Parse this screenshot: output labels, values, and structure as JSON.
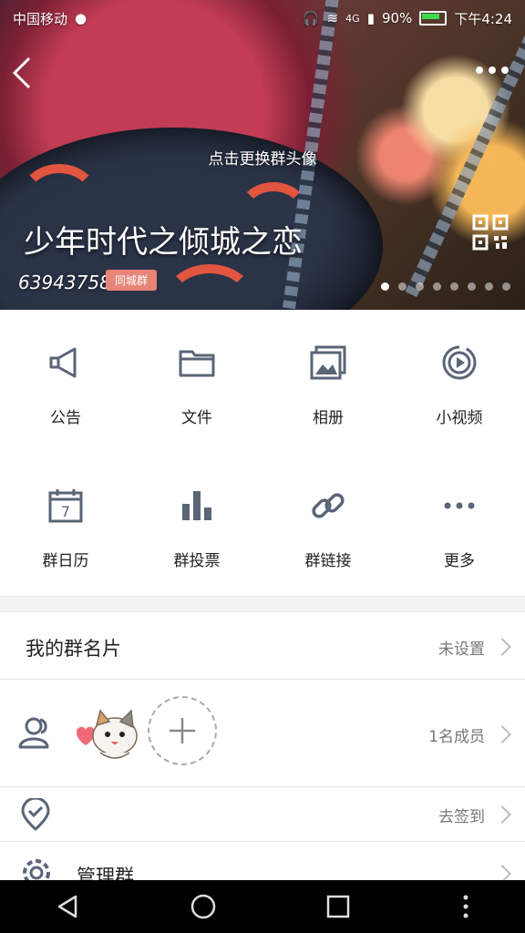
{
  "status_bar": {
    "carrier": "中国移动",
    "network": "4G",
    "battery": "90%",
    "time": "下午4:24"
  },
  "header": {
    "change_avatar_label": "点击更换群头像",
    "group_name": "少年时代之倾城之恋",
    "group_id": "639437589",
    "badge": "同城群",
    "carousel_active_index": 0,
    "carousel_count": 8
  },
  "grid": {
    "row1": [
      {
        "label": "公告",
        "icon": "megaphone-icon"
      },
      {
        "label": "文件",
        "icon": "folder-icon"
      },
      {
        "label": "相册",
        "icon": "photo-album-icon"
      },
      {
        "label": "小视频",
        "icon": "video-icon"
      }
    ],
    "row2": [
      {
        "label": "群日历",
        "icon": "calendar-icon"
      },
      {
        "label": "群投票",
        "icon": "bar-chart-icon"
      },
      {
        "label": "群链接",
        "icon": "link-icon"
      },
      {
        "label": "更多",
        "icon": "more-icon"
      }
    ],
    "calendar_day": "7"
  },
  "rows": {
    "card_title": "我的群名片",
    "card_value": "未设置",
    "members_value": "1名成员",
    "checkin_value": "去签到",
    "manage_title": "管理群"
  },
  "colors": {
    "icon": "#5a6577",
    "badge": "#e98479"
  }
}
